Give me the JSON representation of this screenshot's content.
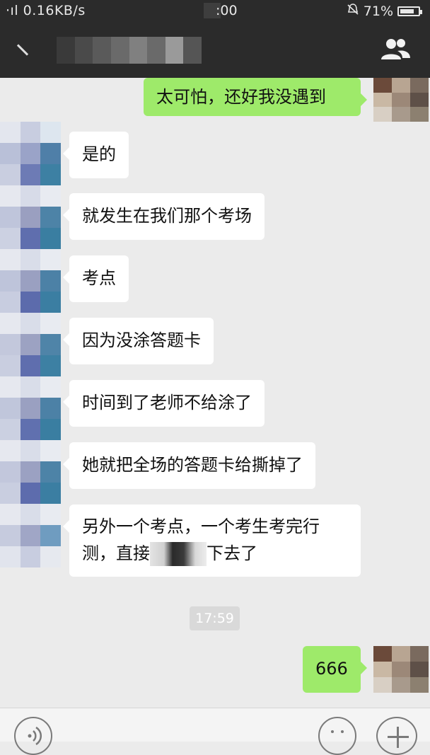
{
  "status_bar": {
    "left_text": "·ıl 0.16KB/s",
    "time_partial": ":00",
    "battery_text": "71%",
    "icons": [
      "signal-icon",
      "alarm-icon",
      "battery-icon"
    ]
  },
  "header": {
    "back_icon": "back-arrow-icon",
    "group_icon": "group-members-icon"
  },
  "messages": [
    {
      "side": "right",
      "text": "太可怕，还好我没遇到"
    },
    {
      "side": "left",
      "text": "是的"
    },
    {
      "side": "left",
      "text": "就发生在我们那个考场"
    },
    {
      "side": "left",
      "text": "考点"
    },
    {
      "side": "left",
      "text": "因为没涂答题卡"
    },
    {
      "side": "left",
      "text": "时间到了老师不给涂了"
    },
    {
      "side": "left",
      "text": "她就把全场的答题卡给撕掉了"
    },
    {
      "side": "left",
      "text_line1": "另外一个考点，一个考生考完行",
      "text_line2_a": "测，直接",
      "text_line2_b": "下去了"
    },
    {
      "side": "right",
      "text": "666"
    }
  ],
  "timestamp": "17:59",
  "input_bar": {
    "left_icon": "voice-icon",
    "emoji_icon": "emoji-icon",
    "plus_icon": "plus-icon"
  },
  "colors": {
    "header_bg": "#2b2b2b",
    "chat_bg": "#ebebeb",
    "my_bubble": "#9eea6a",
    "their_bubble": "#ffffff"
  }
}
